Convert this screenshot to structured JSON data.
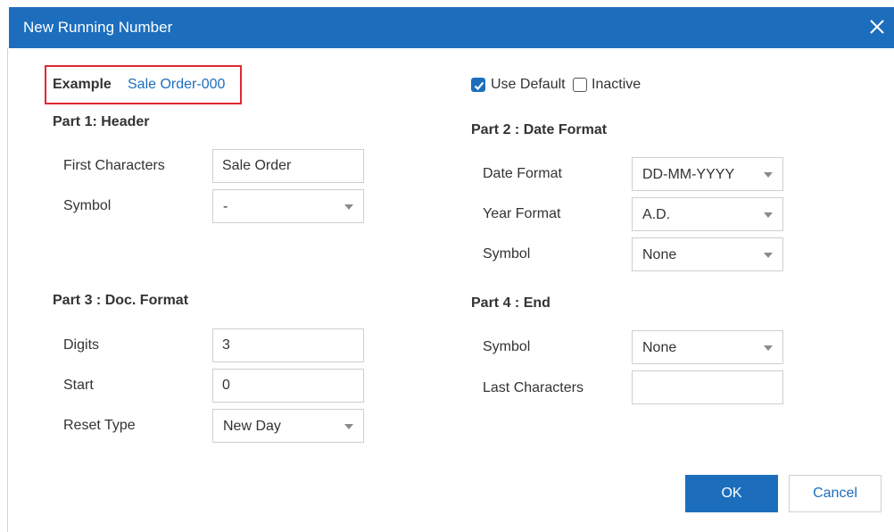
{
  "dialog": {
    "title": "New Running Number"
  },
  "example": {
    "label": "Example",
    "value": "Sale Order-000"
  },
  "options": {
    "use_default": {
      "label": "Use Default",
      "checked": true
    },
    "inactive": {
      "label": "Inactive",
      "checked": false
    }
  },
  "part1": {
    "title": "Part 1: Header",
    "first_characters": {
      "label": "First Characters",
      "value": "Sale Order"
    },
    "symbol": {
      "label": "Symbol",
      "value": "-"
    }
  },
  "part2": {
    "title": "Part 2 : Date Format",
    "date_format": {
      "label": "Date Format",
      "value": "DD-MM-YYYY"
    },
    "year_format": {
      "label": "Year Format",
      "value": "A.D."
    },
    "symbol": {
      "label": "Symbol",
      "value": "None"
    }
  },
  "part3": {
    "title": "Part 3 : Doc. Format",
    "digits": {
      "label": "Digits",
      "value": "3"
    },
    "start": {
      "label": "Start",
      "value": "0"
    },
    "reset_type": {
      "label": "Reset Type",
      "value": "New Day"
    }
  },
  "part4": {
    "title": "Part 4 : End",
    "symbol": {
      "label": "Symbol",
      "value": "None"
    },
    "last_characters": {
      "label": "Last Characters",
      "value": ""
    }
  },
  "buttons": {
    "ok": "OK",
    "cancel": "Cancel"
  },
  "colors": {
    "accent": "#1c6ebd",
    "highlight_border": "#e0282e"
  },
  "icons": {
    "close": "close-icon",
    "dropdown": "chevron-down-icon",
    "check": "check-icon"
  }
}
